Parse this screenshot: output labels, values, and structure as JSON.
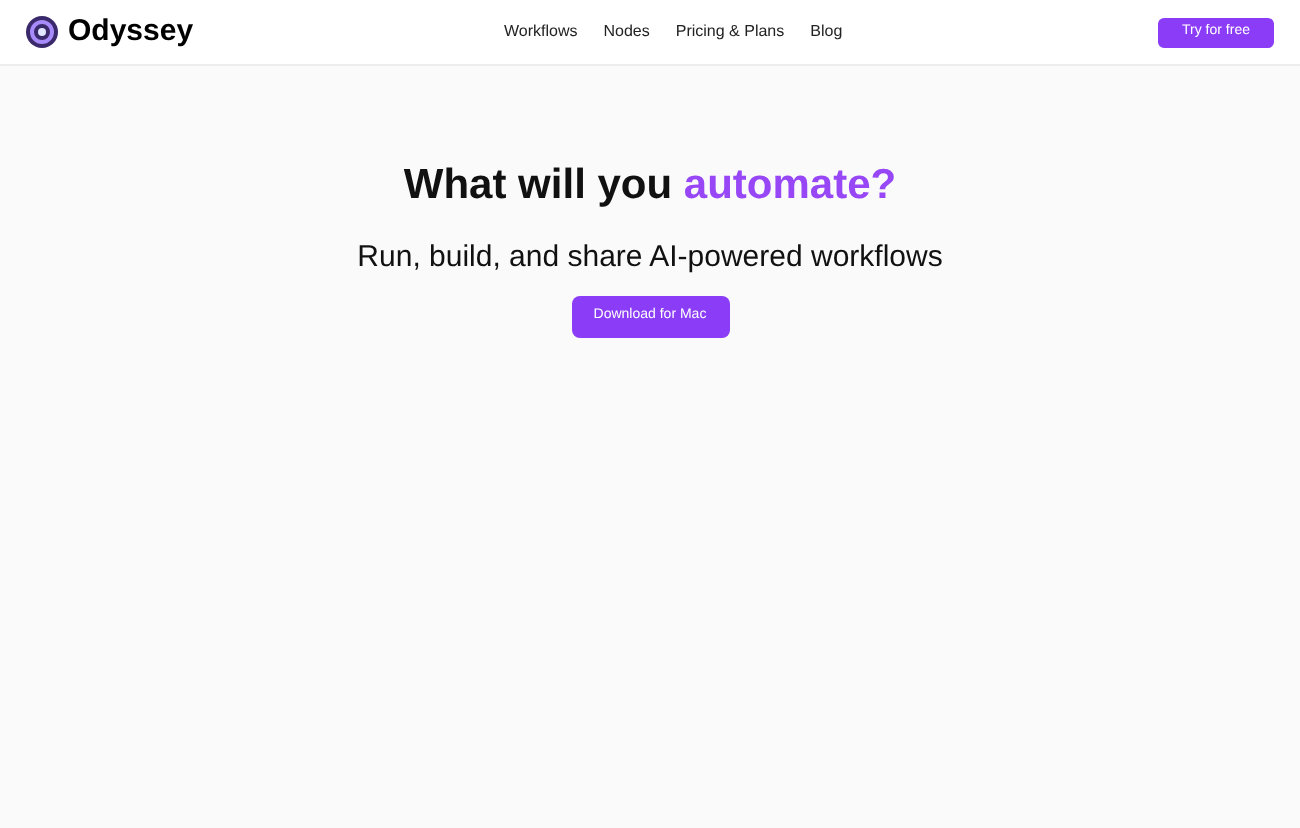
{
  "header": {
    "brand": "Odyssey",
    "nav": [
      {
        "label": "Workflows"
      },
      {
        "label": "Nodes"
      },
      {
        "label": "Pricing & Plans"
      },
      {
        "label": "Blog"
      }
    ],
    "cta": "Try for free"
  },
  "hero": {
    "heading": "What will you ",
    "heading_highlight": "automate?",
    "subtitle": "Run, build, and share AI-powered workflows",
    "button": "Download for Mac"
  }
}
